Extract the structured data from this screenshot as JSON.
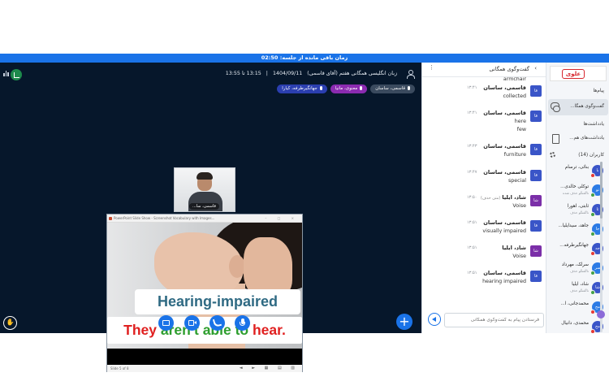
{
  "timer": {
    "label": "زمان باقی مانده از جلسه: 02:50"
  },
  "session": {
    "title": "زبان انگلیسی همگانی هفتم (آقای قاسمی)",
    "date": "1404/09/11",
    "sep": "|",
    "time": "13:15 تا 13:55"
  },
  "chips": [
    {
      "label": "قاسمی، ساسان",
      "color": "#3a4a5e"
    },
    {
      "label": "معنوی، مانیا",
      "color": "#8b2bb0"
    },
    {
      "label": "جهانگیرطرفه، کیارا",
      "color": "#2b3fb0"
    }
  ],
  "webcam": {
    "name": "قاسمی، سا..."
  },
  "slide": {
    "window_title": "PowerPoint Slide Show - Screenshot Vocabulary with Images...",
    "line1": "Hearing-impaired",
    "line2_a": "They ",
    "line2_b": "aren't able to ",
    "line2_c": "hear.",
    "line2_colors": [
      "#e02020",
      "#2e9e2e",
      "#e02020"
    ],
    "footer": "Slide 5 of 8"
  },
  "chat": {
    "title": "گفت‌وگوی همگانی",
    "input_placeholder": "فرستادن پیام به گفت‌وگوی همگانی",
    "messages": [
      {
        "name": "",
        "time": "",
        "text": "armchair",
        "text2": "",
        "av": "",
        "av_color": ""
      },
      {
        "name": "قاسمی، ساسان",
        "time": "۱۳:۴۱",
        "text": "collected",
        "text2": "",
        "av": "قا",
        "av_color": "#3a55c8"
      },
      {
        "name": "قاسمی، ساسان",
        "time": "۱۳:۴۱",
        "text": "here",
        "text2": "few",
        "av": "قا",
        "av_color": "#3a55c8"
      },
      {
        "name": "قاسمی، ساسان",
        "time": "۱۳:۴۳",
        "text": "furniture",
        "text2": "",
        "av": "قا",
        "av_color": "#3a55c8"
      },
      {
        "name": "قاسمی، ساسان",
        "time": "۱۳:۴۷",
        "text": "special",
        "text2": "",
        "av": "قا",
        "av_color": "#3a55c8"
      },
      {
        "name": "شاد، ایلیا",
        "tag": "(متن حذف)",
        "time": "۱۳:۵۰",
        "text": "Voise",
        "text2": "",
        "av": "شا",
        "av_color": "#7b2fa8"
      },
      {
        "name": "قاسمی، ساسان",
        "time": "۱۳:۵۱",
        "text": "visually impaired",
        "text2": "",
        "av": "قا",
        "av_color": "#3a55c8"
      },
      {
        "name": "شاد، ایلیا",
        "time": "۱۳:۵۱",
        "text": "Voise",
        "text2": "",
        "av": "شا",
        "av_color": "#7b2fa8"
      },
      {
        "name": "قاسمی، ساسان",
        "time": "۱۳:۵۱",
        "text": "hearing impaired",
        "text2": "",
        "av": "قا",
        "av_color": "#3a55c8"
      }
    ]
  },
  "sidebar": {
    "logo": "علوی",
    "messages_title": "پیام‌ها",
    "public_chat": "گفت‌وگوی همگا...",
    "notes_title": "یادداشت‌ها",
    "shared_notes": "یادداشت‌های هم...",
    "users_title": "کاربران (14)",
    "users": [
      {
        "name": "بنائی، ترسام",
        "sub": "",
        "av": "با",
        "av_color": "#3a55c8",
        "dot": "#e53935"
      },
      {
        "name": "توکلی خالدی...",
        "sub": "ناگفتگو حذف شده",
        "av": "تو",
        "av_color": "#2c7be5",
        "dot": "#43a047"
      },
      {
        "name": "ثابتی، اهورا",
        "sub": "ناگفتگو حذف",
        "av": "ثا",
        "av_color": "#3a55c8",
        "dot": "#43a047"
      },
      {
        "name": "جاهد، سیدایلیا...",
        "sub": "",
        "av": "جا",
        "av_color": "#2c7be5",
        "dot": "#43a047"
      },
      {
        "name": "جهانگیرطرفه...",
        "sub": "",
        "av": "جه",
        "av_color": "#3a55c8",
        "dot": "#e53935"
      },
      {
        "name": "سرلک، مهرداد",
        "sub": "ناگفتگو حذف",
        "av": "سر",
        "av_color": "#2c7be5",
        "dot": "#43a047"
      },
      {
        "name": "شاد، ایلیا",
        "sub": "ناگفتگو حذف",
        "av": "شا",
        "av_color": "#3a55c8",
        "dot": "#43a047"
      },
      {
        "name": "محمدجانی، ا...",
        "sub": "",
        "av": "مح",
        "av_color": "#2c7be5",
        "dot": "#e53935"
      },
      {
        "name": "محمدی، دانیال",
        "sub": "",
        "av": "مح",
        "av_color": "#3a55c8",
        "dot": "#e53935"
      }
    ]
  },
  "icons": {
    "chat_options": "kebab-menu-icon",
    "back": "chevron-left-icon",
    "send": "send-arrow-icon",
    "raise_hand": "hand-icon",
    "plus": "plus-icon"
  }
}
